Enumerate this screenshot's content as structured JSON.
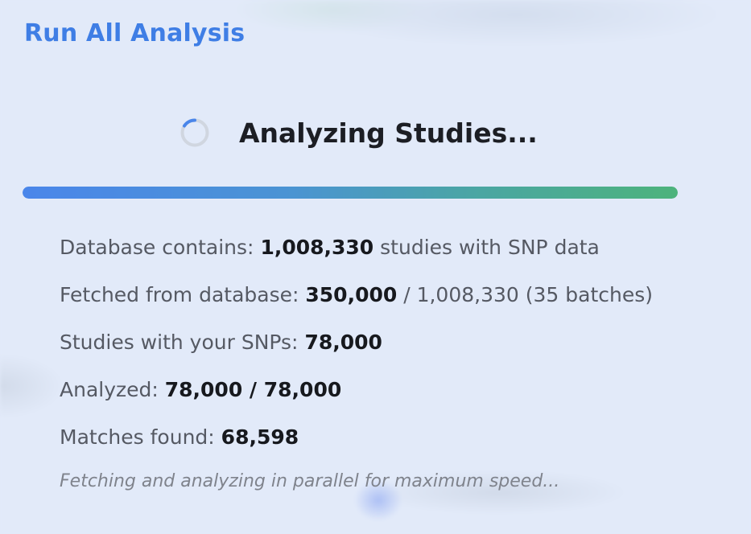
{
  "title": "Run All Analysis",
  "status": {
    "text": "Analyzing Studies...",
    "spinner_icon": "loading-spinner-icon"
  },
  "progress": {
    "percent": 100,
    "gradient_start": "#4a86ea",
    "gradient_end": "#4db37c"
  },
  "stats": {
    "database": {
      "label": "Database contains: ",
      "value": "1,008,330",
      "suffix": " studies with SNP data"
    },
    "fetched": {
      "label": "Fetched from database: ",
      "value": "350,000",
      "suffix": " / 1,008,330 (35 batches)"
    },
    "with_snps": {
      "label": "Studies with your SNPs: ",
      "value": "78,000"
    },
    "analyzed": {
      "label": "Analyzed: ",
      "value": "78,000 / 78,000"
    },
    "matches": {
      "label": "Matches found: ",
      "value": "68,598"
    }
  },
  "note": "Fetching and analyzing in parallel for maximum speed...",
  "colors": {
    "title": "#3f7ee5",
    "background": "#e2eaf9"
  }
}
